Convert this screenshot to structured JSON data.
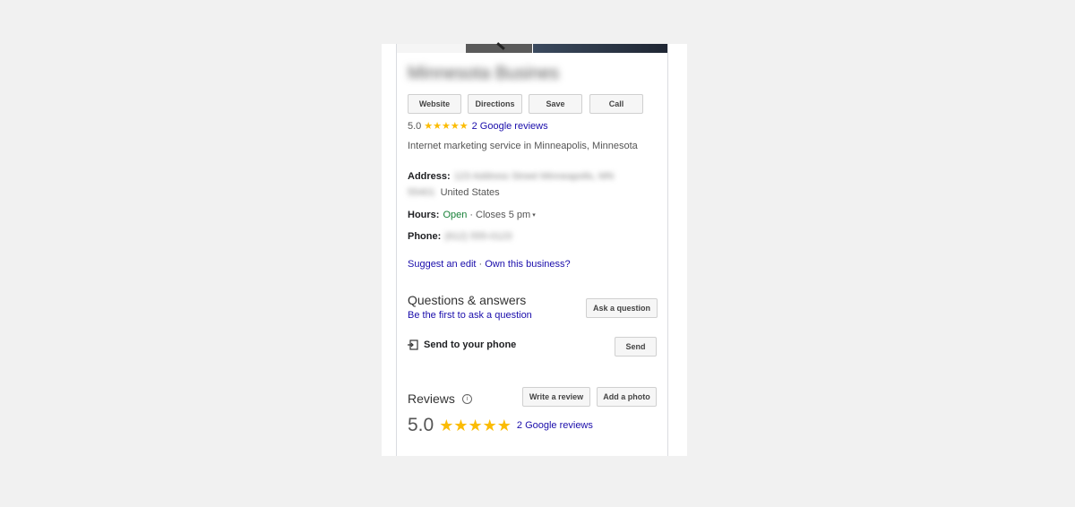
{
  "business": {
    "name": "Minnesota Business"
  },
  "actions": {
    "website": "Website",
    "directions": "Directions",
    "save": "Save",
    "call": "Call"
  },
  "summary": {
    "rating": "5.0",
    "stars": "★★★★★",
    "reviews_link": "2 Google reviews",
    "category": "Internet marketing service in Minneapolis, Minnesota"
  },
  "details": {
    "address_label": "Address:",
    "address_line1": "123 Address Street Minneapolis, MN",
    "address_zip": "55401",
    "address_country": "United States",
    "hours_label": "Hours:",
    "hours_open": "Open",
    "hours_sep": "·",
    "hours_closes": "Closes 5 pm",
    "hours_caret": "▾",
    "phone_label": "Phone:",
    "phone_value": "(612) 555-0123"
  },
  "edit": {
    "suggest": "Suggest an edit",
    "sep": "·",
    "own": "Own this business?"
  },
  "qa": {
    "title": "Questions & answers",
    "subtitle": "Be the first to ask a question",
    "ask_button": "Ask a question"
  },
  "send": {
    "label": "Send to your phone",
    "button": "Send"
  },
  "reviews": {
    "title": "Reviews",
    "info": "i",
    "write_button": "Write a review",
    "photo_button": "Add a photo",
    "rating": "5.0",
    "stars": "★★★★★",
    "link": "2 Google reviews"
  }
}
